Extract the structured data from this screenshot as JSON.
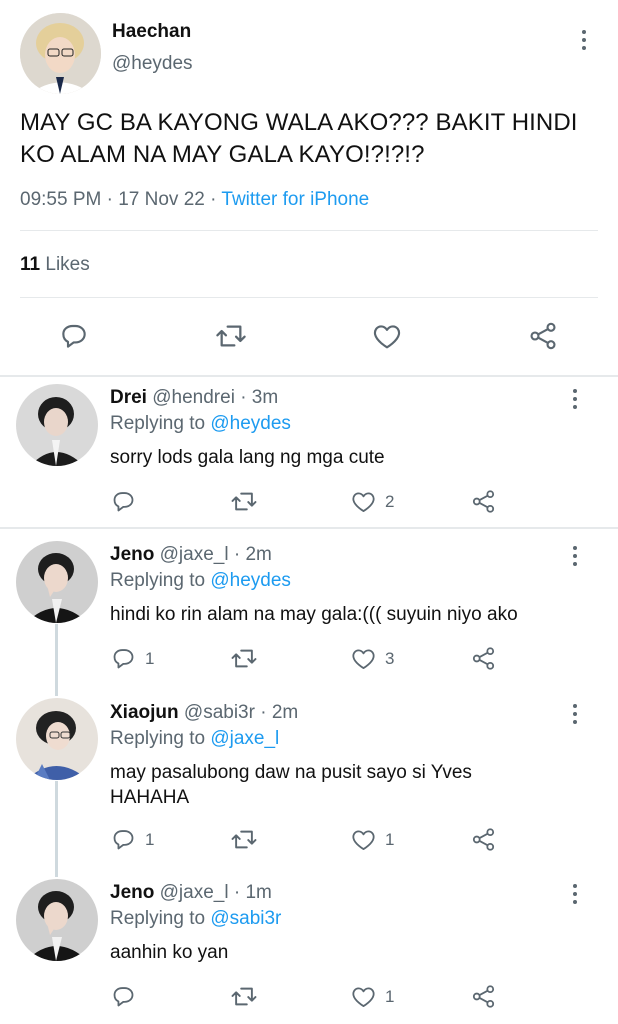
{
  "main": {
    "name": "Haechan",
    "handle": "@heydes",
    "text": "MAY GC BA KAYONG WALA AKO??? BAKIT HINDI KO ALAM NA MAY GALA KAYO!?!?!?",
    "time": "09:55 PM",
    "date": "17 Nov 22",
    "dot": "·",
    "source": "Twitter for iPhone",
    "likes_count": "11",
    "likes_label": "Likes"
  },
  "replying_prefix": "Replying to",
  "replies": [
    {
      "name": "Drei",
      "handle": "@hendrei",
      "time": "· 3m",
      "replying_to": "@heydes",
      "text": "sorry lods gala lang ng mga cute",
      "reply_count": "",
      "retweet_count": "",
      "like_count": "2"
    },
    {
      "name": "Jeno",
      "handle": "@jaxe_l",
      "time": "· 2m",
      "replying_to": "@heydes",
      "text": "hindi ko rin alam na may gala:((( suyuin niyo ako",
      "reply_count": "1",
      "retweet_count": "",
      "like_count": "3"
    },
    {
      "name": "Xiaojun",
      "handle": "@sabi3r",
      "time": "· 2m",
      "replying_to": "@jaxe_l",
      "text": "may pasalubong daw na pusit sayo si Yves HAHAHA",
      "reply_count": "1",
      "retweet_count": "",
      "like_count": "1"
    },
    {
      "name": "Jeno",
      "handle": "@jaxe_l",
      "time": "· 1m",
      "replying_to": "@sabi3r",
      "text": "aanhin ko yan",
      "reply_count": "",
      "retweet_count": "",
      "like_count": "1"
    }
  ],
  "colors": {
    "link": "#1d9bf0",
    "muted": "#5b6770",
    "divider": "#e6e9eb"
  },
  "icons": [
    "more-vertical-icon",
    "reply-icon",
    "retweet-icon",
    "like-icon",
    "share-icon"
  ]
}
